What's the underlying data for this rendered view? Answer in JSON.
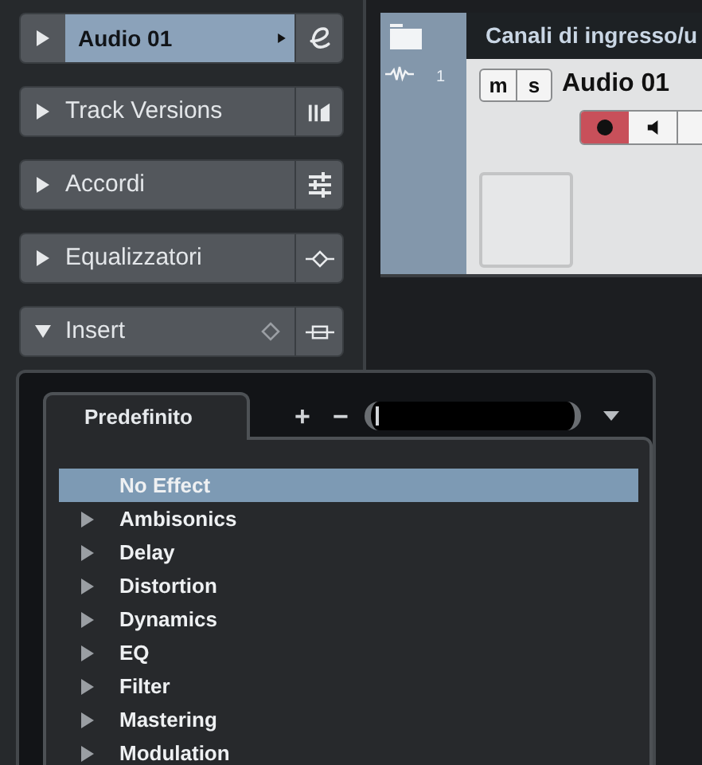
{
  "inspector": {
    "sections": [
      {
        "kind": "track",
        "label": "Audio 01",
        "expanded": false,
        "selected": true
      },
      {
        "kind": "versions",
        "label": "Track Versions",
        "expanded": false,
        "selected": false
      },
      {
        "kind": "chords",
        "label": "Accordi",
        "expanded": false,
        "selected": false
      },
      {
        "kind": "eq",
        "label": "Equalizzatori",
        "expanded": false,
        "selected": false
      },
      {
        "kind": "insert",
        "label": "Insert",
        "expanded": true,
        "selected": false
      }
    ]
  },
  "track_list": {
    "header": "Canali di ingresso/u",
    "track": {
      "number": "1",
      "mute_label": "m",
      "solo_label": "s",
      "name": "Audio 01",
      "record_enabled": true,
      "monitor": false
    }
  },
  "preset_popup": {
    "tab": "Predefinito",
    "add": "+",
    "remove": "−",
    "items": [
      {
        "label": "No Effect",
        "selected": true,
        "folder": false
      },
      {
        "label": "Ambisonics",
        "selected": false,
        "folder": true
      },
      {
        "label": "Delay",
        "selected": false,
        "folder": true
      },
      {
        "label": "Distortion",
        "selected": false,
        "folder": true
      },
      {
        "label": "Dynamics",
        "selected": false,
        "folder": true
      },
      {
        "label": "EQ",
        "selected": false,
        "folder": true
      },
      {
        "label": "Filter",
        "selected": false,
        "folder": true
      },
      {
        "label": "Mastering",
        "selected": false,
        "folder": true
      },
      {
        "label": "Modulation",
        "selected": false,
        "folder": true
      }
    ]
  }
}
